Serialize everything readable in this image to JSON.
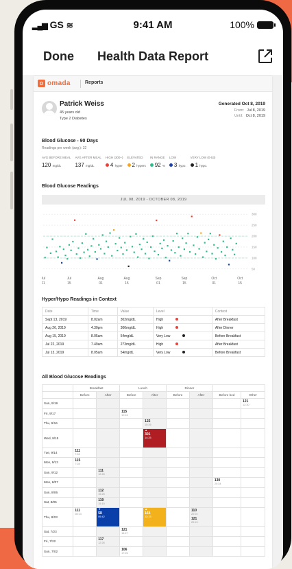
{
  "status_bar": {
    "carrier": "GS",
    "time": "9:41 AM",
    "battery": "100%"
  },
  "nav": {
    "done_label": "Done",
    "title": "Health Data Report"
  },
  "report": {
    "brand": "omada",
    "section": "Reports",
    "patient": {
      "name": "Patrick Weiss",
      "age": "45 years old",
      "condition": "Type 2 Diabetes"
    },
    "generated": "Generated Oct 8, 2019",
    "from_label": "From:",
    "from_date": "Jul 8, 2019",
    "until_label": "Until:",
    "until_date": "Oct 8, 2019"
  },
  "summary": {
    "title": "Blood Glucose - 90 Days",
    "subtitle": "Readings per week (avg.): 32",
    "stats": [
      {
        "label": "AVG BEFORE MEAL",
        "value": "120",
        "unit": "mg/dL",
        "dot": ""
      },
      {
        "label": "AVG AFTER MEAL",
        "value": "137",
        "unit": "mg/dL",
        "dot": ""
      },
      {
        "label": "HIGH (300+)",
        "value": "4",
        "unit": "hyper",
        "dot": "#e8413a"
      },
      {
        "label": "ELEVATED",
        "value": "2",
        "unit": "hypers",
        "dot": "#f4a623"
      },
      {
        "label": "IN RANGE",
        "value": "92",
        "unit": "%",
        "dot": "#2dbd8a"
      },
      {
        "label": "LOW",
        "value": "3",
        "unit": "hypo.",
        "dot": "#1a3fa8"
      },
      {
        "label": "VERY LOW (0-53)",
        "value": "1",
        "unit": "hypo.",
        "dot": "#222222"
      }
    ]
  },
  "readings_chart": {
    "title": "Blood Glucose Readings",
    "range_label": "JUL 08, 2019 - OCTOBER 08, 2019"
  },
  "chart_data": {
    "type": "scatter",
    "title": "",
    "x_tick_labels": [
      "Jul\n01",
      "Jul\n15",
      "Aug\n01",
      "Aug\n15",
      "Sep\n01",
      "Sep\n15",
      "Oct\n01",
      "Oct\n15"
    ],
    "x_tick_days": [
      0,
      14,
      31,
      45,
      62,
      76,
      92,
      106
    ],
    "y_ticks": [
      50,
      100,
      150,
      200,
      250,
      300
    ],
    "ylim": [
      40,
      310
    ],
    "xlim": [
      0,
      110
    ],
    "grid": true,
    "points": [
      {
        "day": 1,
        "value": 102,
        "color": "#2dbd8a"
      },
      {
        "day": 2,
        "value": 148,
        "color": "#2dbd8a"
      },
      {
        "day": 4,
        "value": 122,
        "color": "#2dbd8a"
      },
      {
        "day": 5,
        "value": 186,
        "color": "#2dbd8a"
      },
      {
        "day": 7,
        "value": 130,
        "color": "#2dbd8a"
      },
      {
        "day": 8,
        "value": 104,
        "color": "#2dbd8a"
      },
      {
        "day": 9,
        "value": 152,
        "color": "#2dbd8a"
      },
      {
        "day": 10,
        "value": 78,
        "color": "#1a3fa8"
      },
      {
        "day": 11,
        "value": 140,
        "color": "#2dbd8a"
      },
      {
        "day": 12,
        "value": 112,
        "color": "#2dbd8a"
      },
      {
        "day": 13,
        "value": 96,
        "color": "#2dbd8a"
      },
      {
        "day": 14,
        "value": 160,
        "color": "#2dbd8a"
      },
      {
        "day": 15,
        "value": 135,
        "color": "#2dbd8a"
      },
      {
        "day": 16,
        "value": 175,
        "color": "#2dbd8a"
      },
      {
        "day": 17,
        "value": 273,
        "color": "#e8413a"
      },
      {
        "day": 18,
        "value": 118,
        "color": "#2dbd8a"
      },
      {
        "day": 19,
        "value": 145,
        "color": "#2dbd8a"
      },
      {
        "day": 20,
        "value": 100,
        "color": "#2dbd8a"
      },
      {
        "day": 21,
        "value": 168,
        "color": "#2dbd8a"
      },
      {
        "day": 22,
        "value": 126,
        "color": "#2dbd8a"
      },
      {
        "day": 23,
        "value": 210,
        "color": "#2dbd8a"
      },
      {
        "day": 24,
        "value": 138,
        "color": "#2dbd8a"
      },
      {
        "day": 25,
        "value": 108,
        "color": "#2dbd8a"
      },
      {
        "day": 26,
        "value": 155,
        "color": "#2dbd8a"
      },
      {
        "day": 27,
        "value": 188,
        "color": "#2dbd8a"
      },
      {
        "day": 28,
        "value": 128,
        "color": "#2dbd8a"
      },
      {
        "day": 29,
        "value": 95,
        "color": "#1a3fa8"
      },
      {
        "day": 30,
        "value": 160,
        "color": "#2dbd8a"
      },
      {
        "day": 31,
        "value": 142,
        "color": "#2dbd8a"
      },
      {
        "day": 32,
        "value": 205,
        "color": "#2dbd8a"
      },
      {
        "day": 33,
        "value": 120,
        "color": "#2dbd8a"
      },
      {
        "day": 34,
        "value": 176,
        "color": "#2dbd8a"
      },
      {
        "day": 35,
        "value": 150,
        "color": "#2dbd8a"
      },
      {
        "day": 36,
        "value": 214,
        "color": "#2dbd8a"
      },
      {
        "day": 37,
        "value": 110,
        "color": "#2dbd8a"
      },
      {
        "day": 38,
        "value": 228,
        "color": "#f4a623"
      },
      {
        "day": 39,
        "value": 165,
        "color": "#2dbd8a"
      },
      {
        "day": 40,
        "value": 134,
        "color": "#2dbd8a"
      },
      {
        "day": 41,
        "value": 192,
        "color": "#2dbd8a"
      },
      {
        "day": 42,
        "value": 148,
        "color": "#2dbd8a"
      },
      {
        "day": 43,
        "value": 118,
        "color": "#2dbd8a"
      },
      {
        "day": 44,
        "value": 170,
        "color": "#2dbd8a"
      },
      {
        "day": 45,
        "value": 136,
        "color": "#2dbd8a"
      },
      {
        "day": 46,
        "value": 62,
        "color": "#222222"
      },
      {
        "day": 47,
        "value": 198,
        "color": "#2dbd8a"
      },
      {
        "day": 48,
        "value": 152,
        "color": "#2dbd8a"
      },
      {
        "day": 49,
        "value": 126,
        "color": "#2dbd8a"
      },
      {
        "day": 50,
        "value": 210,
        "color": "#2dbd8a"
      },
      {
        "day": 51,
        "value": 104,
        "color": "#2dbd8a"
      },
      {
        "day": 52,
        "value": 162,
        "color": "#2dbd8a"
      },
      {
        "day": 53,
        "value": 140,
        "color": "#2dbd8a"
      },
      {
        "day": 54,
        "value": 188,
        "color": "#2dbd8a"
      },
      {
        "day": 55,
        "value": 120,
        "color": "#2dbd8a"
      },
      {
        "day": 56,
        "value": 172,
        "color": "#2dbd8a"
      },
      {
        "day": 57,
        "value": 98,
        "color": "#2dbd8a"
      },
      {
        "day": 58,
        "value": 150,
        "color": "#2dbd8a"
      },
      {
        "day": 59,
        "value": 200,
        "color": "#2dbd8a"
      },
      {
        "day": 60,
        "value": 131,
        "color": "#2dbd8a"
      },
      {
        "day": 61,
        "value": 272,
        "color": "#e8413a"
      },
      {
        "day": 62,
        "value": 115,
        "color": "#2dbd8a"
      },
      {
        "day": 63,
        "value": 166,
        "color": "#2dbd8a"
      },
      {
        "day": 64,
        "value": 144,
        "color": "#2dbd8a"
      },
      {
        "day": 65,
        "value": 182,
        "color": "#2dbd8a"
      },
      {
        "day": 66,
        "value": 102,
        "color": "#2dbd8a"
      },
      {
        "day": 67,
        "value": 156,
        "color": "#2dbd8a"
      },
      {
        "day": 68,
        "value": 88,
        "color": "#1a3fa8"
      },
      {
        "day": 69,
        "value": 136,
        "color": "#2dbd8a"
      },
      {
        "day": 70,
        "value": 178,
        "color": "#2dbd8a"
      },
      {
        "day": 71,
        "value": 124,
        "color": "#2dbd8a"
      },
      {
        "day": 72,
        "value": 212,
        "color": "#2dbd8a"
      },
      {
        "day": 73,
        "value": 150,
        "color": "#2dbd8a"
      },
      {
        "day": 74,
        "value": 110,
        "color": "#2dbd8a"
      },
      {
        "day": 75,
        "value": 190,
        "color": "#2dbd8a"
      },
      {
        "day": 76,
        "value": 140,
        "color": "#2dbd8a"
      },
      {
        "day": 77,
        "value": 168,
        "color": "#2dbd8a"
      },
      {
        "day": 78,
        "value": 212,
        "color": "#2dbd8a"
      },
      {
        "day": 79,
        "value": 128,
        "color": "#2dbd8a"
      },
      {
        "day": 80,
        "value": 290,
        "color": "#e8413a"
      },
      {
        "day": 81,
        "value": 158,
        "color": "#2dbd8a"
      },
      {
        "day": 82,
        "value": 118,
        "color": "#2dbd8a"
      },
      {
        "day": 83,
        "value": 196,
        "color": "#2dbd8a"
      },
      {
        "day": 84,
        "value": 142,
        "color": "#2dbd8a"
      },
      {
        "day": 85,
        "value": 214,
        "color": "#f4a623"
      },
      {
        "day": 86,
        "value": 104,
        "color": "#2dbd8a"
      },
      {
        "day": 87,
        "value": 170,
        "color": "#2dbd8a"
      },
      {
        "day": 88,
        "value": 130,
        "color": "#2dbd8a"
      },
      {
        "day": 89,
        "value": 185,
        "color": "#2dbd8a"
      },
      {
        "day": 90,
        "value": 212,
        "color": "#2dbd8a"
      },
      {
        "day": 91,
        "value": 120,
        "color": "#2dbd8a"
      },
      {
        "day": 92,
        "value": 160,
        "color": "#2dbd8a"
      },
      {
        "day": 93,
        "value": 96,
        "color": "#2dbd8a"
      },
      {
        "day": 94,
        "value": 146,
        "color": "#2dbd8a"
      },
      {
        "day": 95,
        "value": 205,
        "color": "#e8413a"
      },
      {
        "day": 96,
        "value": 128,
        "color": "#2dbd8a"
      },
      {
        "day": 97,
        "value": 176,
        "color": "#2dbd8a"
      },
      {
        "day": 98,
        "value": 112,
        "color": "#2dbd8a"
      },
      {
        "day": 99,
        "value": 150,
        "color": "#2dbd8a"
      },
      {
        "day": 100,
        "value": 70,
        "color": "#1a3fa8"
      },
      {
        "day": 101,
        "value": 190,
        "color": "#2dbd8a"
      },
      {
        "day": 102,
        "value": 138,
        "color": "#2dbd8a"
      },
      {
        "day": 103,
        "value": 116,
        "color": "#2dbd8a"
      },
      {
        "day": 104,
        "value": 166,
        "color": "#2dbd8a"
      }
    ]
  },
  "context_table": {
    "title": "Hyper/Hypo Readings in Context",
    "headers": [
      "Date",
      "Time",
      "Value",
      "Level",
      "Context"
    ],
    "rows": [
      {
        "date": "Sept 13, 2019",
        "time": "8.02am",
        "value": "302mg/dL",
        "level": "High",
        "dot": "#e8413a",
        "context": "After Breakfast"
      },
      {
        "date": "Aug 26, 2019",
        "time": "4.30pm",
        "value": "300mg/dL",
        "level": "High",
        "dot": "#e8413a",
        "context": "After Dinner"
      },
      {
        "date": "Aug 15, 2019",
        "time": "8.05am",
        "value": "54mg/dL",
        "level": "Very Low",
        "dot": "#222222",
        "context": "Before Breakfast"
      },
      {
        "date": "Jul 22, 2019",
        "time": "7.49am",
        "value": "273mg/dL",
        "level": "High",
        "dot": "#e8413a",
        "context": "After Breakfast"
      },
      {
        "date": "Jul 13, 2019",
        "time": "8.05am",
        "value": "54mg/dL",
        "level": "Very Low",
        "dot": "#222222",
        "context": "Before Breakfast"
      }
    ]
  },
  "all_readings": {
    "title": "All Blood Glucose Readings",
    "groups": [
      "Breakfast",
      "Lunch",
      "Dinner"
    ],
    "subheaders": [
      "Before",
      "After",
      "Before",
      "After",
      "Before",
      "After",
      "Before bed",
      "Other"
    ],
    "rows": [
      {
        "day": "Sun, 9/19",
        "cells": [
          null,
          null,
          null,
          null,
          null,
          null,
          null,
          {
            "v": "121",
            "t": "12:30"
          }
        ]
      },
      {
        "day": "Fri, 9/17",
        "cells": [
          null,
          null,
          {
            "v": "115",
            "t": "10:16"
          },
          null,
          null,
          null,
          null,
          null
        ]
      },
      {
        "day": "Thu, 9/16",
        "cells": [
          null,
          null,
          null,
          {
            "v": "122",
            "t": "15:26"
          },
          null,
          null,
          null,
          null
        ]
      },
      {
        "day": "Wed, 9/15",
        "tall": true,
        "cells": [
          null,
          null,
          null,
          {
            "v": "301",
            "t": "14:25",
            "c": "red",
            "mark": "▲"
          },
          null,
          null,
          null,
          null
        ]
      },
      {
        "day": "Tue, 9/14",
        "cells": [
          {
            "v": "111",
            "t": "7:28"
          },
          null,
          null,
          null,
          null,
          null,
          null,
          null
        ]
      },
      {
        "day": "Mon, 9/13",
        "cells": [
          {
            "v": "115",
            "t": "7:28"
          },
          null,
          null,
          null,
          null,
          null,
          null,
          null
        ]
      },
      {
        "day": "Sun, 9/12",
        "cells": [
          null,
          {
            "v": "111",
            "t": "12:45"
          },
          null,
          null,
          null,
          null,
          null,
          null
        ]
      },
      {
        "day": "Mon, 8/07",
        "cells": [
          null,
          null,
          null,
          null,
          null,
          null,
          {
            "v": "130",
            "t": "20:34"
          },
          null
        ]
      },
      {
        "day": "Sun, 8/06",
        "cells": [
          null,
          {
            "v": "112",
            "t": "15:25"
          },
          null,
          null,
          null,
          null,
          null,
          null
        ]
      },
      {
        "day": "Sat, 8/05",
        "cells": [
          null,
          {
            "v": "119",
            "t": "15:15"
          },
          null,
          null,
          null,
          null,
          null,
          null
        ]
      },
      {
        "day": "Thu, 8/03",
        "tall": true,
        "cells": [
          {
            "v": "111",
            "t": "08:13"
          },
          {
            "v": "58",
            "t": "09:42",
            "c": "blue",
            "mark": "▼"
          },
          null,
          {
            "v": "164",
            "t": "13:15",
            "c": "yellow",
            "mark": "▲"
          },
          null,
          {
            "v": "110",
            "t": "20:04",
            "v2": "121",
            "t2": "20:13"
          },
          null,
          null
        ]
      },
      {
        "day": "Sat, 7/23",
        "cells": [
          null,
          null,
          {
            "v": "121",
            "t": "14:27"
          },
          null,
          null,
          null,
          null,
          null
        ]
      },
      {
        "day": "Fri, 7/22",
        "cells": [
          null,
          {
            "v": "117",
            "t": "12:26"
          },
          null,
          null,
          null,
          null,
          null,
          null
        ]
      },
      {
        "day": "Sun, 7/02",
        "cells": [
          null,
          null,
          {
            "v": "106",
            "t": "17:26"
          },
          null,
          null,
          null,
          null,
          null
        ]
      }
    ]
  },
  "colors": {
    "brand": "#f26b3a",
    "in_range": "#2dbd8a",
    "high": "#e8413a",
    "elevated": "#f4a623",
    "low": "#1a3fa8",
    "very_low": "#222222"
  }
}
